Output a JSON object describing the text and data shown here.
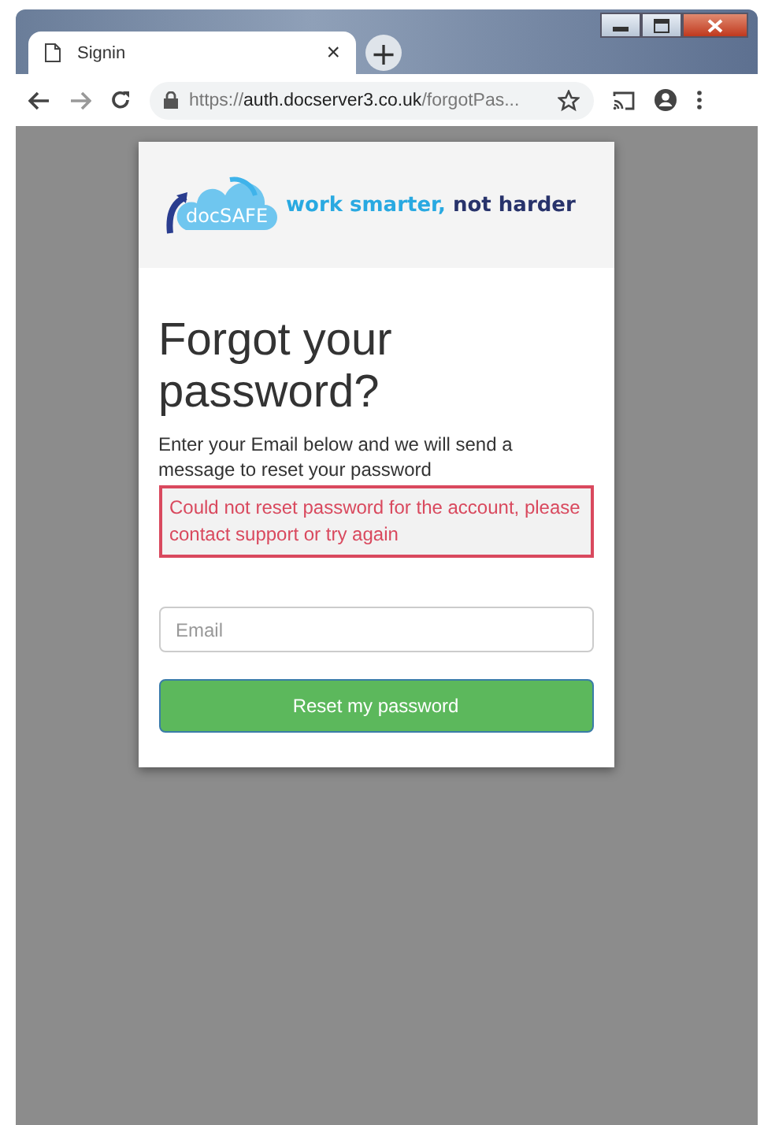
{
  "browser": {
    "tab": {
      "title": "Signin",
      "close": "×"
    },
    "new_tab": "+",
    "url": {
      "scheme": "https://",
      "host": "auth.docserver3.co.uk",
      "path": "/forgotPas..."
    }
  },
  "logo": {
    "brand": "docSAFE",
    "tagline_light": "work smarter,",
    "tagline_dark": "not harder"
  },
  "heading": "Forgot your password?",
  "instructions": "Enter your Email below and we will send a message to reset your password",
  "error": "Could not reset password for the account, please contact support or try again",
  "email": {
    "placeholder": "Email"
  },
  "button": "Reset my password"
}
